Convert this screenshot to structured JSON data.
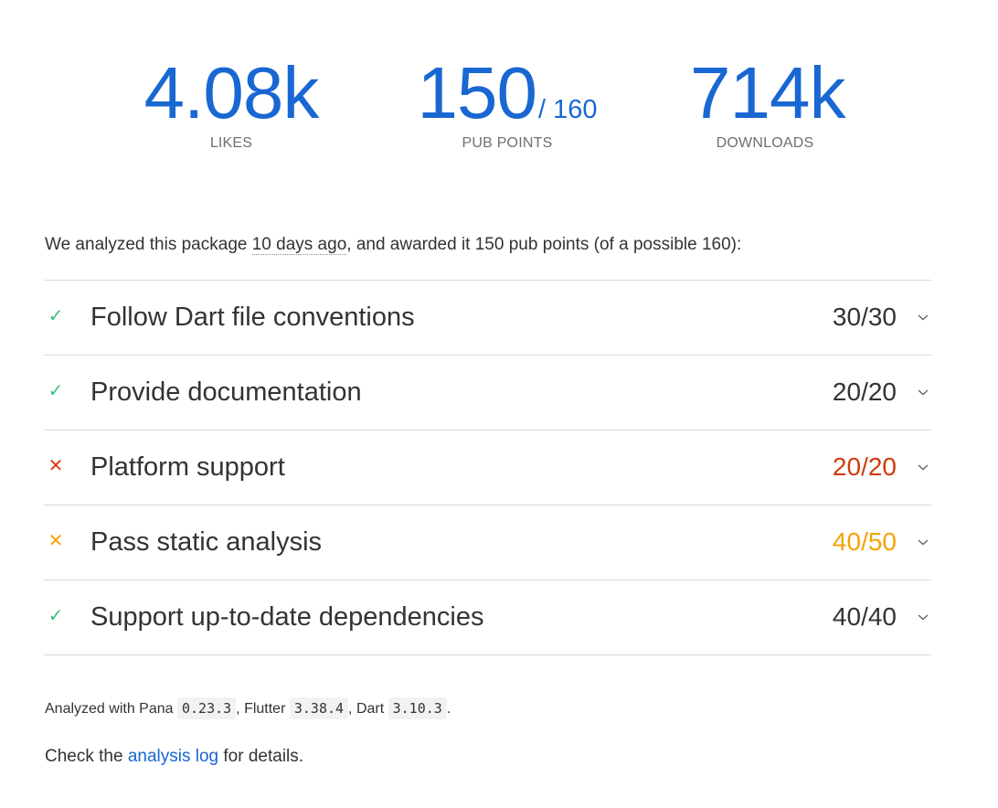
{
  "scores": {
    "likes": {
      "value": "4.08k",
      "label": "LIKES"
    },
    "points": {
      "value": "150",
      "max": "/ 160",
      "label": "PUB POINTS"
    },
    "downloads": {
      "value": "714k",
      "label": "DOWNLOADS"
    }
  },
  "summary": {
    "prefix": "We analyzed this package ",
    "ago": "10 days ago",
    "suffix": ", and awarded it 150 pub points (of a possible 160):"
  },
  "sections": [
    {
      "title": "Follow Dart file conventions",
      "score": "30/30",
      "status": "good",
      "icon": "check-icon"
    },
    {
      "title": "Provide documentation",
      "score": "20/20",
      "status": "good",
      "icon": "check-icon"
    },
    {
      "title": "Platform support",
      "score": "20/20",
      "status": "bad",
      "icon": "cross-icon"
    },
    {
      "title": "Pass static analysis",
      "score": "40/50",
      "status": "warn",
      "icon": "cross-icon"
    },
    {
      "title": "Support up-to-date dependencies",
      "score": "40/40",
      "status": "good",
      "icon": "check-icon"
    }
  ],
  "footer": {
    "analyzed_prefix": "Analyzed with Pana ",
    "pana_version": "0.23.3",
    "flutter_prefix": ", Flutter ",
    "flutter_version": "3.38.4",
    "dart_prefix": ", Dart ",
    "dart_version": "3.10.3",
    "analyzed_suffix": ".",
    "check_prefix": "Check the ",
    "log_link": "analysis log",
    "check_suffix": " for details."
  },
  "colors": {
    "accent": "#1967d2",
    "good": "#3fbf7a",
    "bad": "#e03b1a",
    "warn": "#f4a300"
  }
}
